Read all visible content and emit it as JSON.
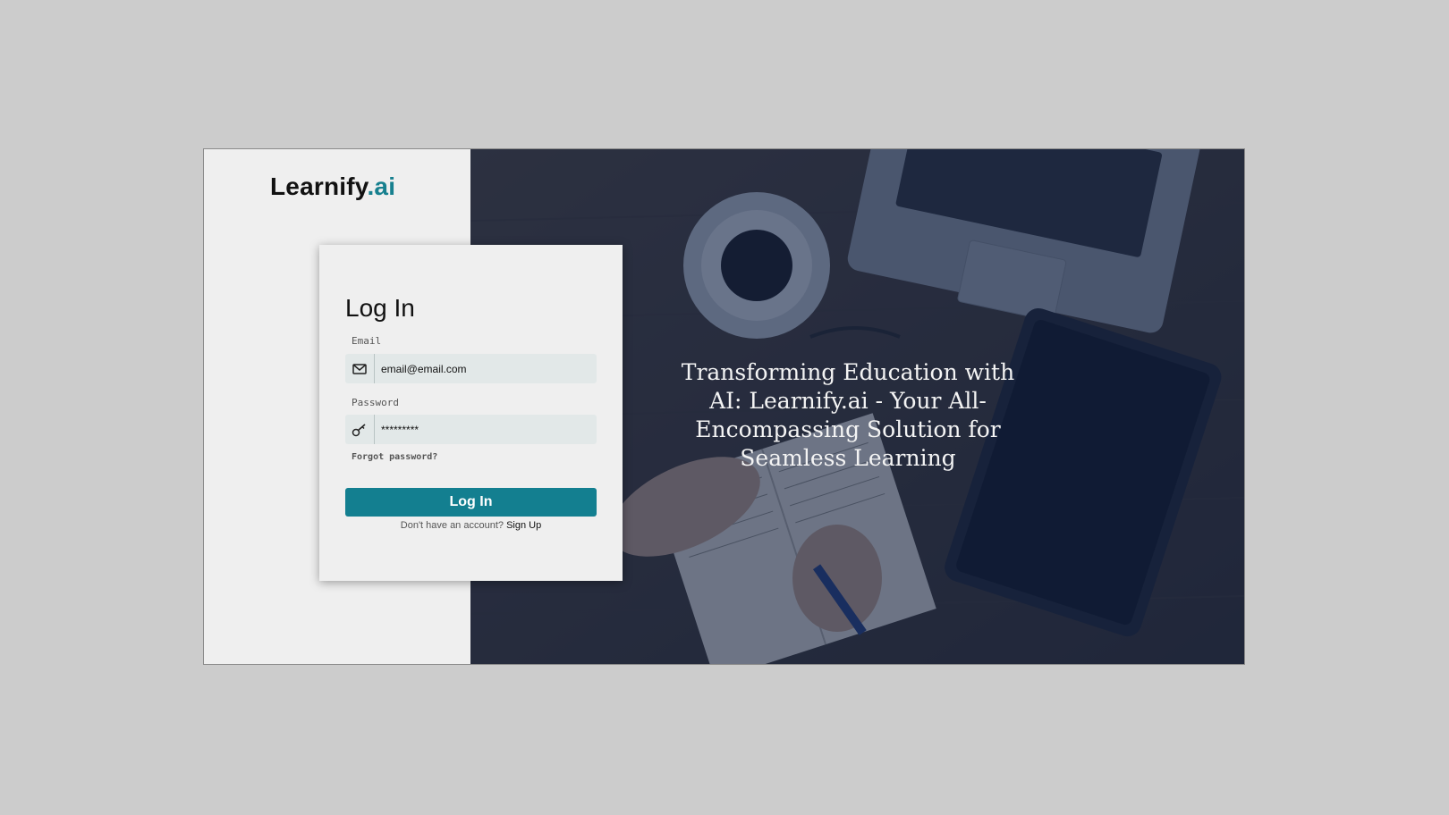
{
  "brand": {
    "name_main": "Learnify",
    "name_accent": ".ai",
    "accent_color": "#17808f"
  },
  "login_card": {
    "title": "Log In",
    "email": {
      "label": "Email",
      "value": "email@email.com",
      "icon": "mail-icon"
    },
    "password": {
      "label": "Password",
      "value": "*********",
      "icon": "key-icon"
    },
    "forgot_password": "Forgot password?",
    "submit_label": "Log In",
    "signup_prompt": "Don't have an account?",
    "signup_link": "Sign Up",
    "button_color": "#137f90"
  },
  "hero": {
    "headline": "Transforming Education with AI: Learnify.ai - Your All-Encompassing Solution for Seamless Learning",
    "overlay_color": "#142448"
  }
}
